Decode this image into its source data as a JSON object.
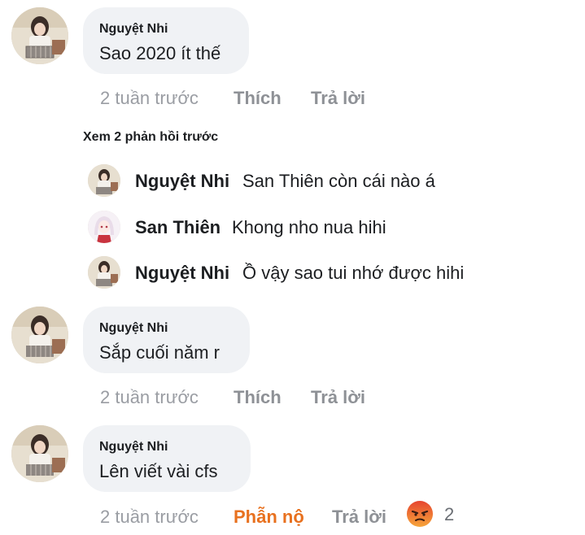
{
  "comments": [
    {
      "name": "Nguyệt Nhi",
      "text": "Sao 2020 ít thế",
      "time": "2 tuần trước",
      "like": "Thích",
      "reply": "Trả lời"
    },
    {
      "name": "Nguyệt Nhi",
      "text": "Sắp cuối năm r",
      "time": "2 tuần trước",
      "like": "Thích",
      "reply": "Trả lời"
    },
    {
      "name": "Nguyệt Nhi",
      "text": "Lên viết vài cfs",
      "time": "2 tuần trước",
      "like": "Phẫn nộ",
      "reply": "Trả lời",
      "reaction_icon": "angry-emoji-icon",
      "reaction_count": "2"
    }
  ],
  "view_previous": "Xem 2 phản hồi trước",
  "replies": [
    {
      "name": "Nguyệt Nhi",
      "text": "San Thiên còn cái nào á",
      "avatar": "girl-avatar"
    },
    {
      "name": "San Thiên",
      "text": "Khong nho nua hihi",
      "avatar": "anime-avatar"
    },
    {
      "name": "Nguyệt Nhi",
      "text": "Ồ vậy sao tui nhớ được hihi",
      "avatar": "girl-avatar"
    }
  ],
  "colors": {
    "bubble": "#f0f2f5",
    "meta_gray": "#9a9da3",
    "angry_orange": "#e8711f"
  }
}
